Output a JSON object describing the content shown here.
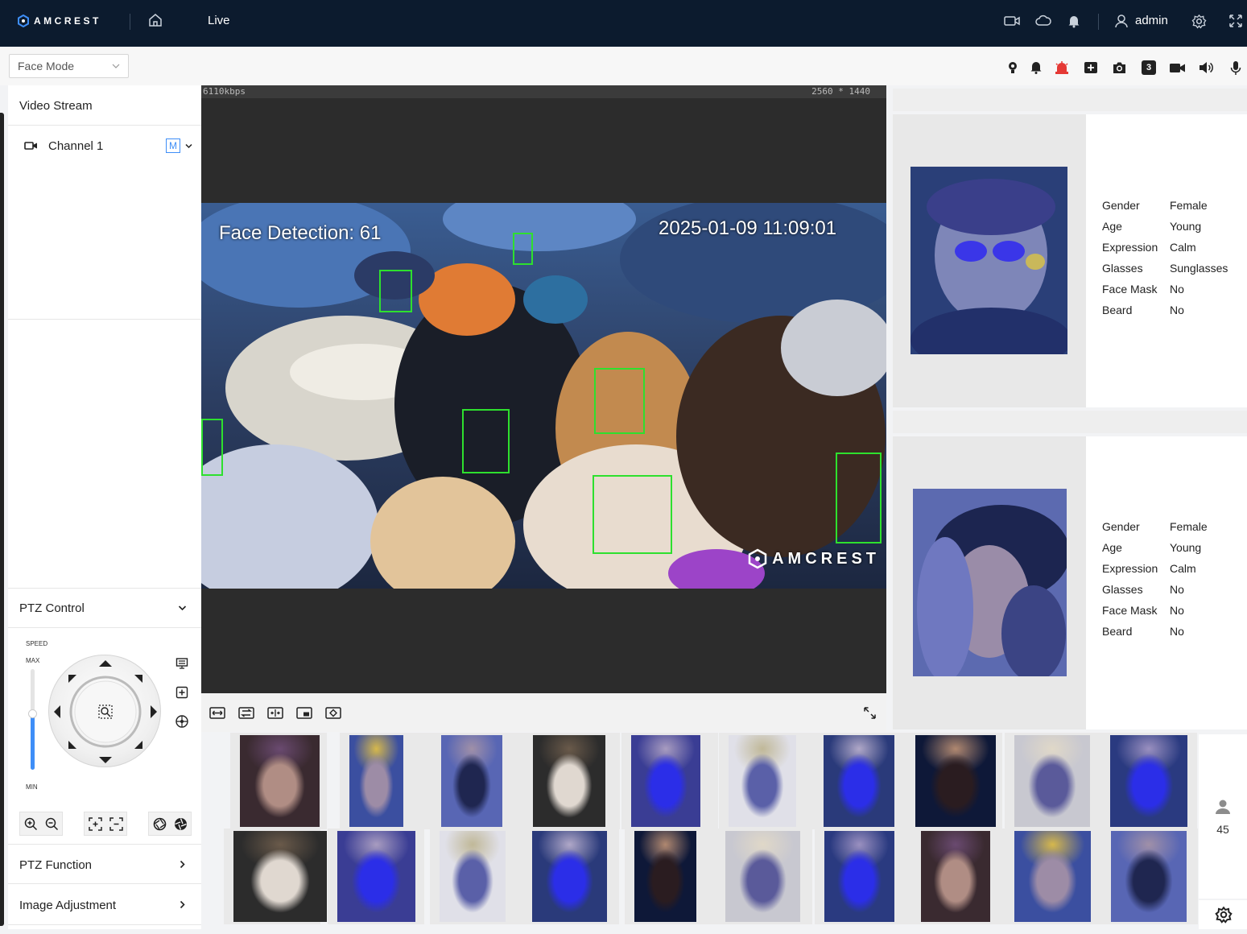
{
  "topbar": {
    "logo_text": "AMCREST",
    "live_label": "Live",
    "user_label": "admin",
    "icons": [
      "home-icon",
      "camera-record-icon",
      "cloud-icon",
      "bell-icon",
      "user-icon",
      "gear-icon",
      "fullscreen-icon"
    ]
  },
  "toolbar": {
    "mode_value": "Face Mode",
    "icons": [
      "light-icon",
      "alarm-bell-icon",
      "siren-icon",
      "add-window-icon",
      "snapshot-icon",
      "triple-snapshot-icon",
      "record-icon",
      "speaker-icon",
      "mic-icon"
    ],
    "triple_label": "3"
  },
  "left": {
    "video_stream": "Video Stream",
    "channel": "Channel 1",
    "stream_badge": "M",
    "ptz_control": "PTZ Control",
    "speed_label": "SPEED",
    "max_label": "MAX",
    "min_label": "MIN",
    "speed_level": 0.55,
    "ptz_function": "PTZ Function",
    "image_adjustment": "Image Adjustment"
  },
  "video": {
    "bitrate": "6110kbps",
    "resolution": "2560 * 1440",
    "overlay_left": "Face Detection: 61",
    "overlay_time": "2025-01-09 11:09:01",
    "watermark": "AMCREST"
  },
  "faces": [
    {
      "attributes": [
        {
          "key": "Gender",
          "value": "Female"
        },
        {
          "key": "Age",
          "value": "Young"
        },
        {
          "key": "Expression",
          "value": "Calm"
        },
        {
          "key": "Glasses",
          "value": "Sunglasses"
        },
        {
          "key": "Face Mask",
          "value": "No"
        },
        {
          "key": "Beard",
          "value": "No"
        }
      ]
    },
    {
      "attributes": [
        {
          "key": "Gender",
          "value": "Female"
        },
        {
          "key": "Age",
          "value": "Young"
        },
        {
          "key": "Expression",
          "value": "Calm"
        },
        {
          "key": "Glasses",
          "value": "No"
        },
        {
          "key": "Face Mask",
          "value": "No"
        },
        {
          "key": "Beard",
          "value": "No"
        }
      ]
    }
  ],
  "face_count": "45",
  "colors": {
    "topbar": "#0c1b2e",
    "detection_box": "#2ee02e",
    "accent": "#3e8ef7",
    "siren": "#e53935"
  }
}
